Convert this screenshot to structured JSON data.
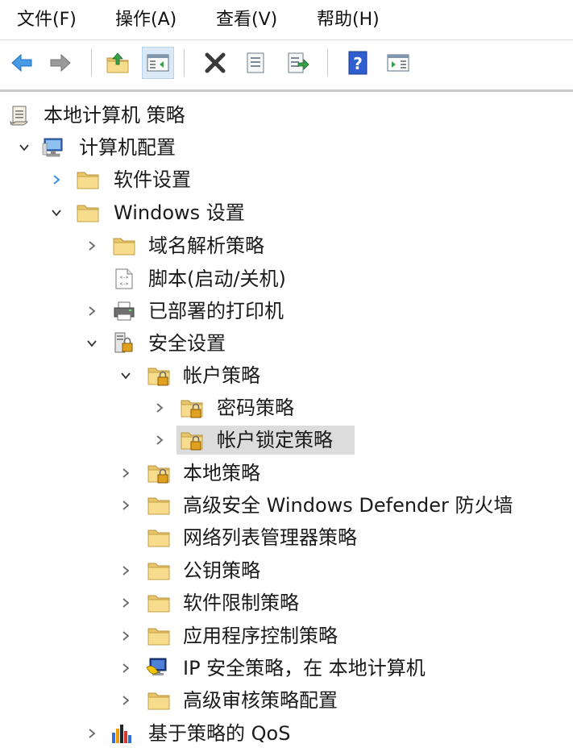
{
  "menu": [
    "文件(F)",
    "操作(A)",
    "查看(V)",
    "帮助(H)"
  ],
  "toolbar": {
    "buttons": [
      "back-icon",
      "forward-icon",
      "up-folder-icon",
      "show-hide-tree-icon",
      "delete-icon",
      "properties-icon",
      "export-list-icon",
      "help-icon",
      "action-pane-icon"
    ]
  },
  "tree": {
    "root": "本地计算机 策略",
    "computer_config": "计算机配置",
    "software_settings": "软件设置",
    "windows_settings": "Windows 设置",
    "dns_policy": "域名解析策略",
    "scripts": "脚本(启动/关机)",
    "printers": "已部署的打印机",
    "security_settings": "安全设置",
    "account_policies": "帐户策略",
    "password_policy": "密码策略",
    "lockout_policy": "帐户锁定策略",
    "local_policies": "本地策略",
    "firewall": "高级安全 Windows Defender 防火墙",
    "network_list": "网络列表管理器策略",
    "public_key": "公钥策略",
    "software_restriction": "软件限制策略",
    "app_control": "应用程序控制策略",
    "ipsec": "IP 安全策略，在 本地计算机",
    "audit": "高级审核策略配置",
    "qos": "基于策略的 QoS"
  }
}
